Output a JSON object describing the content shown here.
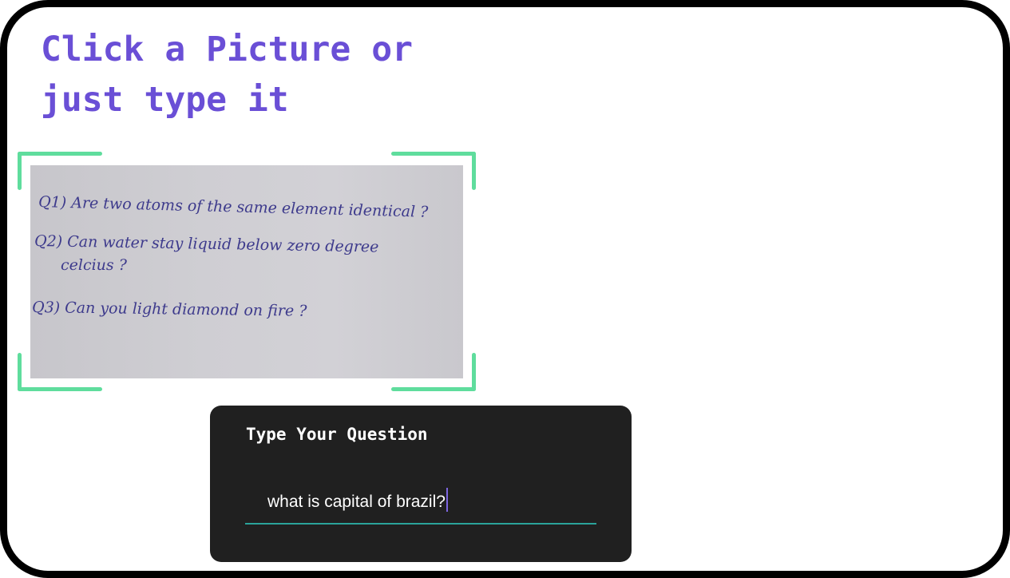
{
  "headline": {
    "line1": "Click a Picture or",
    "line2": "just type it",
    "color": "#6a4fd6"
  },
  "photo": {
    "corner_color": "#5fdd9d",
    "lines": [
      "Q1) Are two atoms of the same element identical ?",
      "Q2) Can water stay liquid below zero degree",
      "celcius ?",
      "Q3) Can you light diamond on fire ?"
    ]
  },
  "question_card": {
    "title": "Type Your Question",
    "input_value": "what is capital of brazil?",
    "underline_color": "#2aa39a",
    "caret_color": "#7d66e0"
  }
}
